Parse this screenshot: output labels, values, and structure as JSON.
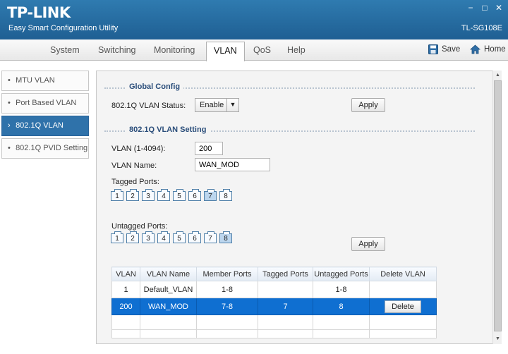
{
  "app": {
    "logo": "TP-LINK",
    "subtitle": "Easy Smart Configuration Utility",
    "model": "TL-SG108E"
  },
  "window_controls": {
    "minimize": "−",
    "maximize": "□",
    "close": "✕"
  },
  "menu": {
    "tabs": [
      "System",
      "Switching",
      "Monitoring",
      "VLAN",
      "QoS",
      "Help"
    ],
    "active_tab": "VLAN",
    "save_label": "Save",
    "home_label": "Home"
  },
  "sidebar": {
    "items": [
      "MTU VLAN",
      "Port Based VLAN",
      "802.1Q VLAN",
      "802.1Q PVID Setting"
    ],
    "active": "802.1Q VLAN",
    "bullet": "•",
    "active_bullet": "›"
  },
  "global_config": {
    "title": "Global Config",
    "status_label": "802.1Q VLAN Status:",
    "status_value": "Enable",
    "apply_label": "Apply"
  },
  "vlan_setting": {
    "title": "802.1Q VLAN Setting",
    "vlan_id_label": "VLAN (1-4094):",
    "vlan_id_value": "200",
    "vlan_name_label": "VLAN Name:",
    "vlan_name_value": "WAN_MOD",
    "tagged_label": "Tagged Ports:",
    "untagged_label": "Untagged Ports:",
    "ports": [
      "1",
      "2",
      "3",
      "4",
      "5",
      "6",
      "7",
      "8"
    ],
    "tagged_selected": [
      "7"
    ],
    "untagged_selected": [
      "8"
    ],
    "apply_label": "Apply"
  },
  "table": {
    "headers": [
      "VLAN",
      "VLAN Name",
      "Member Ports",
      "Tagged Ports",
      "Untagged Ports",
      "Delete VLAN"
    ],
    "rows": [
      {
        "vlan": "1",
        "name": "Default_VLAN",
        "member": "1-8",
        "tagged": "",
        "untagged": "1-8",
        "delete": ""
      },
      {
        "vlan": "200",
        "name": "WAN_MOD",
        "member": "7-8",
        "tagged": "7",
        "untagged": "8",
        "delete": "Delete"
      }
    ]
  },
  "colors": {
    "titlebar": "#1f5f93",
    "accent": "#2f72aa",
    "selected_row": "#0f6fd1"
  }
}
